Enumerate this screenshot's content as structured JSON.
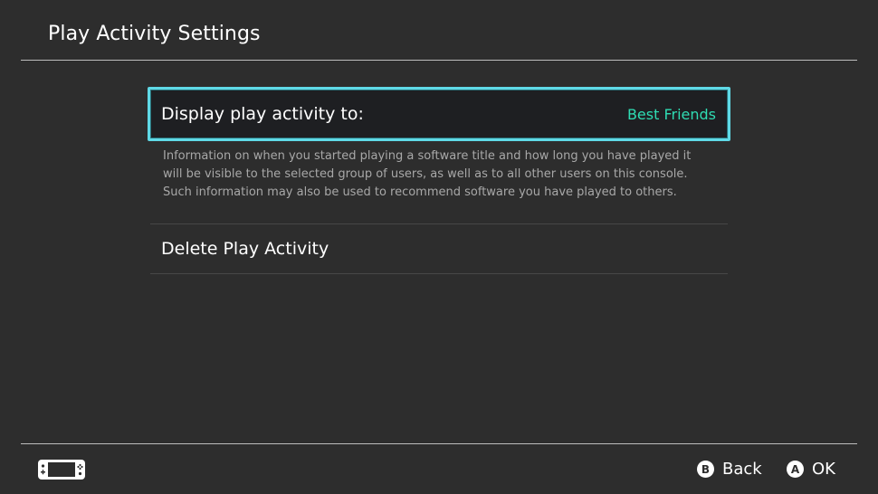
{
  "header": {
    "title": "Play Activity Settings"
  },
  "settings": {
    "display_activity": {
      "label": "Display play activity to:",
      "value": "Best Friends",
      "description_lines": [
        "Information on when you started playing a software title and how long you have played it",
        "will be visible to the selected group of users, as well as to all other users on this console.",
        "Such information may also be used to recommend software you have played to others."
      ]
    },
    "delete_activity": {
      "label": "Delete Play Activity"
    }
  },
  "footer": {
    "back": {
      "glyph": "B",
      "label": "Back"
    },
    "ok": {
      "glyph": "A",
      "label": "OK"
    },
    "console_icon": "handheld-console-icon"
  },
  "colors": {
    "background": "#2d2d2d",
    "selection_border": "#5fd9e6",
    "value_accent": "#2fdcb3",
    "description_text": "#a8a8a8"
  }
}
